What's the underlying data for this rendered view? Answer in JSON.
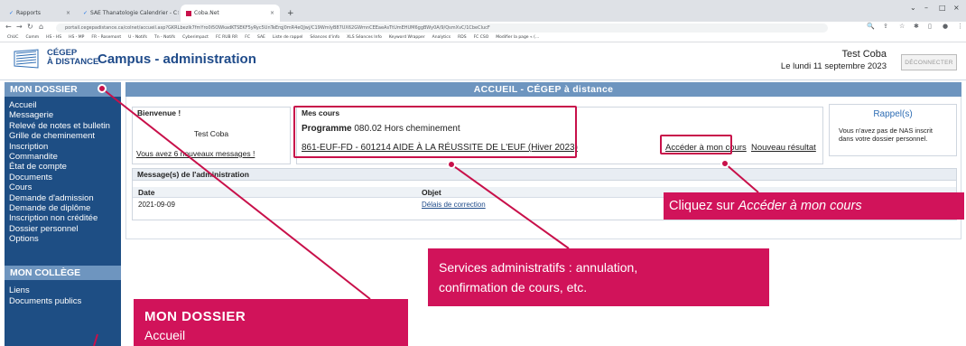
{
  "browser": {
    "tabs": [
      {
        "label": "Rapports",
        "active": false
      },
      {
        "label": "SAE Thanatologie Calendrier - C",
        "active": false
      },
      {
        "label": "Coba.Net",
        "active": true
      }
    ],
    "new_tab": "+",
    "url": "portail.cegepadistance.ca/colnet/accueil.asp?GKRLbezlk7fmYro0i5OWkadKTSEKF5yRyc5UnTeErqj0mR4eQJwj/C19WmlyB87UX62GWmnCEEaeAsTtUmEHUM6ggBWy0A/9/QsmXvC/1CbeClucF",
    "bookmarks": [
      "ChUC",
      "Comm",
      "HS - HS",
      "HS - MP",
      "FR - Rosemont",
      "U - Notifs",
      "Tn - Notifs",
      "Cyberimpact",
      "FC RUB RR",
      "FC",
      "SAE",
      "Liste de rappel",
      "Séances d'info",
      "XLS Séances Info",
      "Keyword Wrapper",
      "Analytics",
      "RDS",
      "FC CSO",
      "Modifier la page « (..."
    ]
  },
  "header": {
    "logo_line1": "CÉGEP",
    "logo_line2": "À DISTANCE",
    "title": "Campus - administration",
    "user": "Test Coba",
    "date": "Le lundi 11 septembre 2023",
    "logout": "DÉCONNECTER"
  },
  "sidebar": {
    "section1_title": "MON DOSSIER",
    "section1_items": [
      "Accueil",
      "Messagerie",
      "Relevé de notes et bulletin",
      "Grille de cheminement",
      "Inscription",
      "Commandite",
      "État de compte",
      "Documents",
      "Cours",
      "Demande d'admission",
      "Demande de diplôme",
      "Inscription non créditée",
      "Dossier personnel",
      "Options"
    ],
    "section2_title": "MON COLLÈGE",
    "section2_items": [
      "Liens",
      "Documents publics"
    ]
  },
  "main": {
    "bar_title": "ACCUEIL - CÉGEP à distance",
    "welcome": {
      "title": "Bienvenue !",
      "name": "Test Coba",
      "messages_link": "Vous avez 6 nouveaux messages !"
    },
    "courses": {
      "title": "Mes cours",
      "program_label": "Programme",
      "program_value": "080.02 Hors cheminement",
      "course_link": "861-EUF-FD - 601214 AIDE À LA RÉUSSITE DE L'EUF (Hiver 2023)",
      "access_link": "Accéder à mon cours",
      "new_result_link": "Nouveau résultat"
    },
    "reminder": {
      "title": "Rappel(s)",
      "text_line1": "Vous n'avez pas de NAS inscrit",
      "text_line2": "dans votre dossier personnel."
    },
    "admin_messages": {
      "title": "Message(s) de l'administration",
      "col_date": "Date",
      "col_subject": "Objet",
      "rows": [
        {
          "date": "2021-09-09",
          "subject": "Délais de correction"
        }
      ]
    }
  },
  "annotations": {
    "callout_access_prefix": "Cliquez sur ",
    "callout_access_emph": "Accéder à mon cours",
    "callout_services_line1": "Services administratifs : annulation,",
    "callout_services_line2": "confirmation de cours, etc.",
    "callout_dossier_title": "MON DOSSIER",
    "callout_dossier_sub": "Accueil"
  },
  "colors": {
    "primary": "#1e4e84",
    "bar": "#6e95bf",
    "accent": "#d1135a"
  }
}
